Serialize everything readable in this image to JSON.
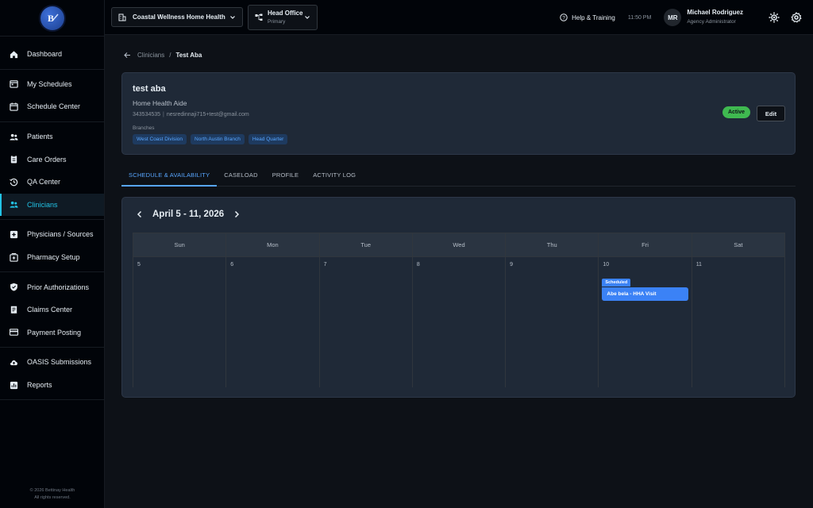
{
  "sidebar": {
    "groups": [
      [
        {
          "label": "Dashboard",
          "icon": "home-icon"
        }
      ],
      [
        {
          "label": "My Schedules",
          "icon": "calendar-icon"
        },
        {
          "label": "Schedule Center",
          "icon": "calendar-grid-icon"
        }
      ],
      [
        {
          "label": "Patients",
          "icon": "people-icon"
        },
        {
          "label": "Care Orders",
          "icon": "clipboard-icon"
        },
        {
          "label": "QA Center",
          "icon": "history-icon"
        },
        {
          "label": "Clinicians",
          "icon": "group-icon"
        }
      ],
      [
        {
          "label": "Physicians / Sources",
          "icon": "plus-box-icon"
        },
        {
          "label": "Pharmacy Setup",
          "icon": "pharmacy-icon"
        }
      ],
      [
        {
          "label": "Prior Authorizations",
          "icon": "shield-check-icon"
        },
        {
          "label": "Claims Center",
          "icon": "receipt-icon"
        },
        {
          "label": "Payment Posting",
          "icon": "credit-card-icon"
        }
      ],
      [
        {
          "label": "OASIS Submissions",
          "icon": "cloud-upload-icon"
        },
        {
          "label": "Reports",
          "icon": "bar-chart-icon"
        }
      ]
    ],
    "active": "Clinicians",
    "copyright_line1": "© 2026 Bettinay Health",
    "copyright_line2": "All rights reserved."
  },
  "topbar": {
    "agency": "Coastal Wellness Home Health",
    "office_name": "Head Office",
    "office_sub": "Primary",
    "help_label": "Help & Training",
    "time": "11:50 PM",
    "avatar_initials": "MR",
    "user_name": "Michael Rodriguez",
    "user_role": "Agency Administrator"
  },
  "breadcrumb": {
    "parent": "Clinicians",
    "separator": "/",
    "current": "Test Aba"
  },
  "profile": {
    "name": "test aba",
    "role": "Home Health Aide",
    "phone": "343534535",
    "email": "nesredinnaji715+test@gmail.com",
    "branches_label": "Branches",
    "branches": [
      "West Coast Division",
      "North Austin Branch",
      "Head Quarter"
    ],
    "status": "Active",
    "edit_label": "Edit"
  },
  "tabs": [
    "SCHEDULE & AVAILABILITY",
    "CASELOAD",
    "PROFILE",
    "ACTIVITY LOG"
  ],
  "active_tab": "SCHEDULE & AVAILABILITY",
  "schedule": {
    "week_title": "April 5 - 11, 2026",
    "days": [
      {
        "name": "Sun",
        "date": "5"
      },
      {
        "name": "Mon",
        "date": "6"
      },
      {
        "name": "Tue",
        "date": "7"
      },
      {
        "name": "Wed",
        "date": "8"
      },
      {
        "name": "Thu",
        "date": "9"
      },
      {
        "name": "Fri",
        "date": "10"
      },
      {
        "name": "Sat",
        "date": "11"
      }
    ],
    "events": [
      {
        "day": "10",
        "status": "Scheduled",
        "title": "Abe bela - HHA Visit"
      }
    ]
  },
  "colors": {
    "accent": "#22c3e6",
    "tab_active": "#58a6ff",
    "event": "#3b82f6",
    "status_active": "#3fb950"
  }
}
